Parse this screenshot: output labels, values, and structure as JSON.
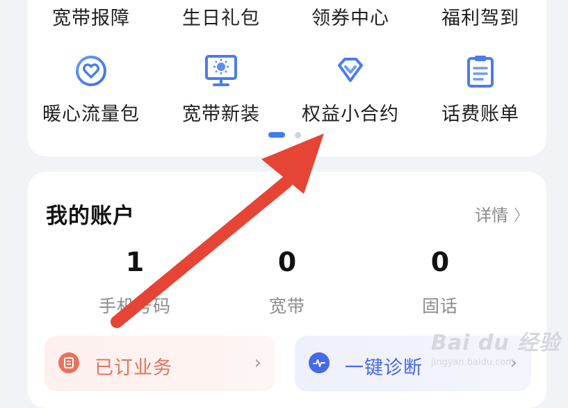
{
  "top_row": {
    "items": [
      {
        "label": "宽带报障"
      },
      {
        "label": "生日礼包"
      },
      {
        "label": "领券中心"
      },
      {
        "label": "福利驾到"
      }
    ]
  },
  "service_grid": {
    "items": [
      {
        "label": "暖心流量包",
        "icon": "heart-icon"
      },
      {
        "label": "宽带新装",
        "icon": "monitor-icon"
      },
      {
        "label": "权益小合约",
        "icon": "diamond-icon"
      },
      {
        "label": "话费账单",
        "icon": "clipboard-icon"
      }
    ],
    "pager": {
      "pages": 2,
      "current_page": 1
    }
  },
  "account": {
    "title": "我的账户",
    "detail_label": "详情",
    "stats": [
      {
        "value": "1",
        "label": "手机号码"
      },
      {
        "value": "0",
        "label": "宽带"
      },
      {
        "value": "0",
        "label": "固话"
      }
    ]
  },
  "actions": {
    "orders_label": "已订业务",
    "diagnose_label": "一键诊断"
  },
  "watermark": {
    "main": "Bai du 经验",
    "sub": "jingyan.baidu.com"
  },
  "colors": {
    "accent_blue": "#3d7cf4",
    "icon_blue": "#4f7ff0",
    "orders_orange": "#e8735c",
    "diagnose_blue": "#4569e8",
    "annotation_red": "#e64535"
  }
}
